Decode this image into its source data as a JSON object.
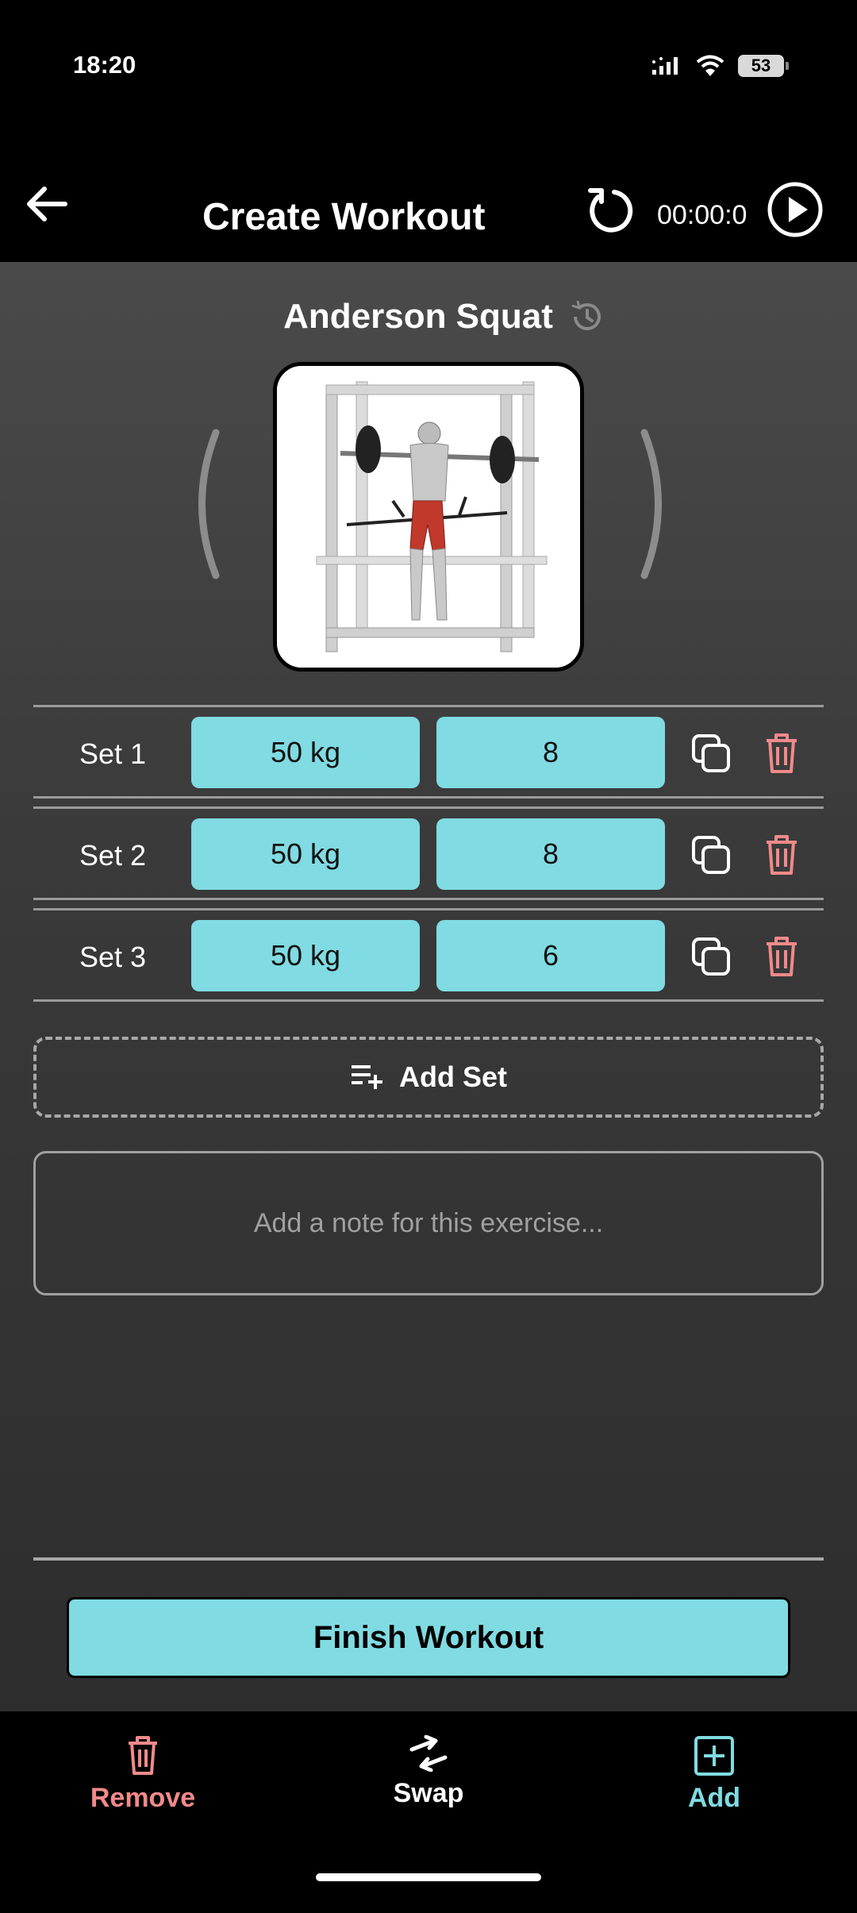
{
  "status_bar": {
    "time": "18:20",
    "battery": "53",
    "icons": [
      "signal-icon",
      "wifi-icon",
      "battery-icon"
    ]
  },
  "app_bar": {
    "title": "Create Workout",
    "timer": "00:00:0",
    "icons": [
      "back-arrow-icon",
      "reset-icon",
      "play-icon"
    ]
  },
  "exercise": {
    "name": "Anderson Squat",
    "icons": [
      "history-icon",
      "chevron-left-icon",
      "chevron-right-icon"
    ]
  },
  "sets": [
    {
      "label": "Set 1",
      "weight": "50 kg",
      "reps": "8"
    },
    {
      "label": "Set 2",
      "weight": "50 kg",
      "reps": "8"
    },
    {
      "label": "Set 3",
      "weight": "50 kg",
      "reps": "6"
    }
  ],
  "add_set_label": "Add Set",
  "note": {
    "placeholder": "Add a note for this exercise...",
    "value": ""
  },
  "finish_label": "Finish Workout",
  "bottom_nav": {
    "remove": "Remove",
    "swap": "Swap",
    "add": "Add"
  },
  "colors": {
    "accent": "#80dbe2",
    "danger": "#f08a8a",
    "background_top": "#4a4a4a",
    "background_bottom": "#2d2d2d"
  }
}
